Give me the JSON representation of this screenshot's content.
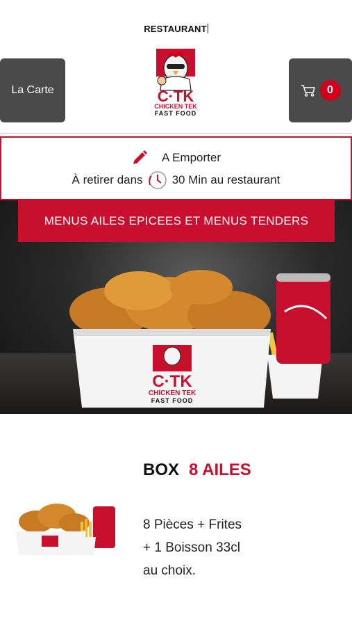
{
  "page": {
    "title": "RESTAURANT"
  },
  "header": {
    "menu_button": "La Carte",
    "cart_count": "0",
    "logo": {
      "main": "C·TK",
      "line1": "CHICKEN TEK",
      "line2": "FAST FOOD"
    }
  },
  "order_mode": {
    "mode": "A Emporter",
    "pickup_prefix": "À retirer dans",
    "pickup_suffix": "30 Min au restaurant"
  },
  "banner": {
    "title": "MENUS AILES EPICEES ET MENUS TENDERS",
    "logo": {
      "main": "C·TK",
      "line1": "CHICKEN TEK",
      "line2": "FAST FOOD"
    }
  },
  "product": {
    "name_part1": "BOX",
    "name_part2": "8 AILES",
    "desc_lines": [
      "8 Pièces  + Frites",
      "+ 1 Boisson 33cl",
      "au choix."
    ]
  },
  "colors": {
    "accent": "#c8102e",
    "dark_button": "#4a4a4a",
    "badge": "#d0021b"
  }
}
